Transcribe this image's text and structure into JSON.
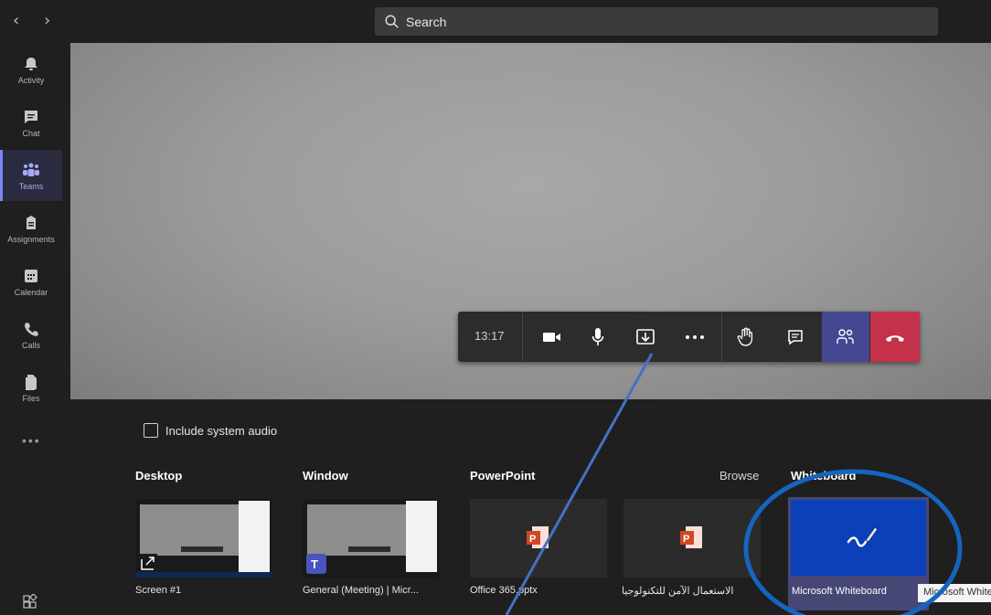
{
  "topbar": {
    "back": "‹",
    "forward": "›",
    "search_placeholder": "Search"
  },
  "rail": [
    {
      "label": "Activity",
      "icon": "bell-icon"
    },
    {
      "label": "Chat",
      "icon": "chat-icon"
    },
    {
      "label": "Teams",
      "icon": "teams-icon",
      "active": true
    },
    {
      "label": "Assignments",
      "icon": "assignments-icon"
    },
    {
      "label": "Calendar",
      "icon": "calendar-icon"
    },
    {
      "label": "Calls",
      "icon": "phone-icon"
    },
    {
      "label": "Files",
      "icon": "files-icon"
    }
  ],
  "rail_more": "•••",
  "meeting": {
    "time": "13:17",
    "buttons": [
      "camera-icon",
      "microphone-icon",
      "share-tray-icon",
      "more-icon",
      "raise-hand-icon",
      "conversation-icon",
      "participants-icon",
      "hang-up-icon"
    ]
  },
  "share": {
    "include_audio": "Include system audio",
    "sections": {
      "desktop": "Desktop",
      "window": "Window",
      "powerpoint": "PowerPoint",
      "browse": "Browse",
      "whiteboard": "Whiteboard"
    },
    "items": {
      "screen": "Screen #1",
      "window": "General (Meeting) | Micr...",
      "ppt1": "Office 365.pptx",
      "ppt2": "الاستعمال الآمن للتكنولوجيا",
      "whiteboard": "Microsoft Whiteboard"
    },
    "tooltip": "Microsoft Whiteboard"
  },
  "colors": {
    "accent": "#444791",
    "hangup": "#c4314b",
    "annotation": "#1565c0",
    "whiteboard_blue": "#0b40b8"
  }
}
